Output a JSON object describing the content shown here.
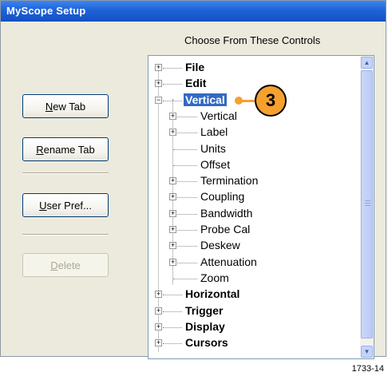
{
  "window": {
    "title": "MyScope Setup"
  },
  "panel_header": "Choose From These Controls",
  "buttons": {
    "new_tab": {
      "label": "New Tab",
      "mnemonic": "N",
      "rest": "ew Tab"
    },
    "rename_tab": {
      "label": "Rename Tab",
      "mnemonic": "R",
      "rest": "ename Tab"
    },
    "user_pref": {
      "label": "User Pref...",
      "mnemonic": "U",
      "rest": "ser Pref..."
    },
    "delete": {
      "label": "Delete",
      "mnemonic": "D",
      "rest": "elete"
    }
  },
  "tree": {
    "items": [
      {
        "label": "File",
        "bold": true,
        "expander": "+"
      },
      {
        "label": "Edit",
        "bold": true,
        "expander": "+"
      },
      {
        "label": "Vertical",
        "bold": true,
        "expander": "−",
        "selected": true
      },
      {
        "label": "Vertical",
        "expander": "+"
      },
      {
        "label": "Label",
        "expander": "+"
      },
      {
        "label": "Units"
      },
      {
        "label": "Offset"
      },
      {
        "label": "Termination",
        "expander": "+"
      },
      {
        "label": "Coupling",
        "expander": "+"
      },
      {
        "label": "Bandwidth",
        "expander": "+"
      },
      {
        "label": "Probe Cal",
        "expander": "+"
      },
      {
        "label": "Deskew",
        "expander": "+"
      },
      {
        "label": "Attenuation",
        "expander": "+"
      },
      {
        "label": "Zoom"
      },
      {
        "label": "Horizontal",
        "bold": true,
        "expander": "+"
      },
      {
        "label": "Trigger",
        "bold": true,
        "expander": "+"
      },
      {
        "label": "Display",
        "bold": true,
        "expander": "+"
      },
      {
        "label": "Cursors",
        "bold": true,
        "expander": "+"
      }
    ]
  },
  "callout": {
    "number": "3"
  },
  "figure_number": "1733-14",
  "colors": {
    "titlebar": "#1f62d8",
    "selection": "#316ac5",
    "callout": "#f6a02e",
    "window_bg": "#eceadd"
  }
}
